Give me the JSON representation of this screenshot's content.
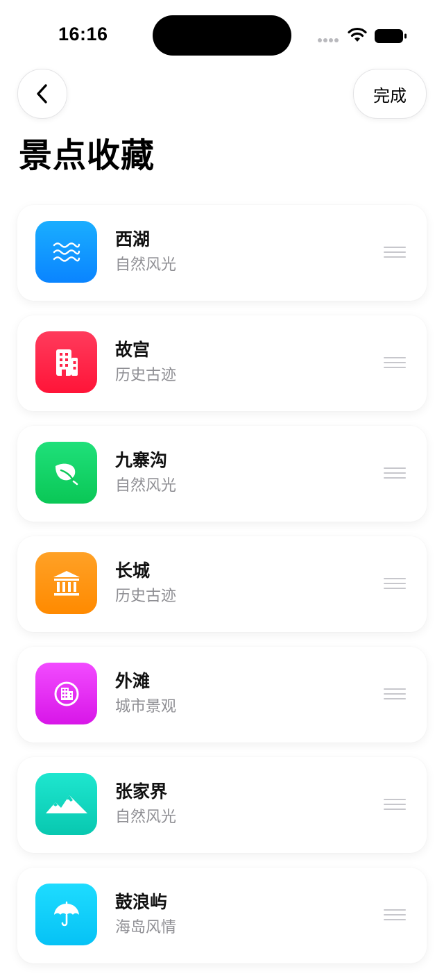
{
  "status_bar": {
    "time": "16:16"
  },
  "nav": {
    "back_icon": "chevron-left-icon",
    "done_label": "完成"
  },
  "title": "景点收藏",
  "items": [
    {
      "name": "西湖",
      "category": "自然风光",
      "icon": "water-waves-icon",
      "color_top": "#1aaeff",
      "color_bottom": "#0a84ff"
    },
    {
      "name": "故宫",
      "category": "历史古迹",
      "icon": "building-icon",
      "color_top": "#ff3b5c",
      "color_bottom": "#ff1438"
    },
    {
      "name": "九寨沟",
      "category": "自然风光",
      "icon": "leaf-icon",
      "color_top": "#1fe07a",
      "color_bottom": "#0ac756"
    },
    {
      "name": "长城",
      "category": "历史古迹",
      "icon": "columns-landmark-icon",
      "color_top": "#ffa126",
      "color_bottom": "#ff8a00"
    },
    {
      "name": "外滩",
      "category": "城市景观",
      "icon": "city-building-circle-icon",
      "color_top": "#f24bff",
      "color_bottom": "#d816e8"
    },
    {
      "name": "张家界",
      "category": "自然风光",
      "icon": "mountains-icon",
      "color_top": "#1ee6cf",
      "color_bottom": "#08c8b0"
    },
    {
      "name": "鼓浪屿",
      "category": "海岛风情",
      "icon": "umbrella-icon",
      "color_top": "#1edcff",
      "color_bottom": "#06c2f5"
    }
  ],
  "drag_handle_icon": "drag-handle-icon"
}
